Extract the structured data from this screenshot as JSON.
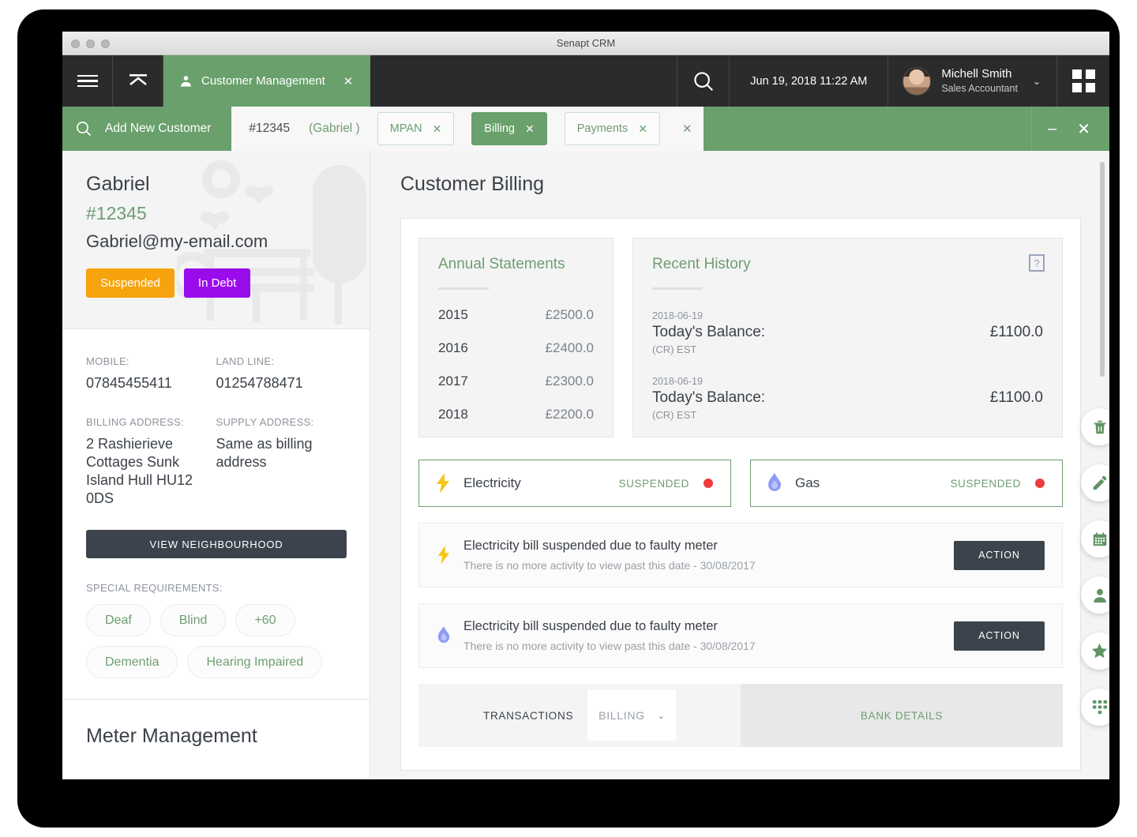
{
  "window": {
    "title": "Senapt CRM"
  },
  "topnav": {
    "menu_icon": "hamburger-icon",
    "collapse_icon": "collapse-up-icon",
    "tab_label": "Customer Management",
    "tab_close": "✕",
    "search_icon": "search-icon",
    "datetime": "Jun 19, 2018 11:22 AM",
    "user_name": "Michell Smith",
    "user_role": "Sales Accountant",
    "user_chevron": "⌄",
    "apps_icon": "grid-apps-icon"
  },
  "subbar": {
    "search_icon": "search-icon",
    "add_label": "Add New Customer",
    "customer_id": "#12345",
    "customer_name": "(Gabriel )",
    "tabs": [
      {
        "label": "MPAN",
        "close": "✕",
        "active": false
      },
      {
        "label": "Billing",
        "close": "✕",
        "active": true
      },
      {
        "label": "Payments",
        "close": "✕",
        "active": false
      }
    ],
    "close_all": "✕",
    "minimize": "–",
    "close": "✕"
  },
  "sidebar": {
    "customer": {
      "name": "Gabriel",
      "id": "#12345",
      "email": "Gabriel@my-email.com"
    },
    "badges": [
      {
        "label": "Suspended",
        "color": "#f7a30d"
      },
      {
        "label": "In Debt",
        "color": "#9b0ced"
      }
    ],
    "fields": [
      {
        "label": "MOBILE:",
        "value": "07845455411"
      },
      {
        "label": "LAND LINE:",
        "value": "01254788471"
      },
      {
        "label": "BILLING ADDRESS:",
        "value": "2 Rashierieve Cottages Sunk Island Hull HU12 0DS"
      },
      {
        "label": "SUPPLY ADDRESS:",
        "value": "Same as billing address"
      }
    ],
    "view_neighbourhood": "VIEW NEIGHBOURHOOD",
    "special_requirements_label": "SPECIAL REQUIREMENTS:",
    "special_requirements": [
      "Deaf",
      "Blind",
      "+60",
      "Dementia",
      "Hearing Impaired"
    ],
    "meter_management_title": "Meter Management"
  },
  "main": {
    "page_title": "Customer Billing",
    "annual": {
      "title": "Annual Statements",
      "rows": [
        {
          "year": "2015",
          "amount": "£2500.0"
        },
        {
          "year": "2016",
          "amount": "£2400.0"
        },
        {
          "year": "2017",
          "amount": "£2300.0"
        },
        {
          "year": "2018",
          "amount": "£2200.0"
        }
      ]
    },
    "history": {
      "title": "Recent History",
      "help": "?",
      "entries": [
        {
          "date": "2018-06-19",
          "label": "Today's Balance:",
          "note": "(CR) EST",
          "amount": "£1100.0"
        },
        {
          "date": "2018-06-19",
          "label": "Today's Balance:",
          "note": "(CR) EST",
          "amount": "£1100.0"
        }
      ]
    },
    "utilities": [
      {
        "icon": "lightning-bolt-icon",
        "name": "Electricity",
        "status": "SUSPENDED",
        "status_color": "#ef3b3b"
      },
      {
        "icon": "flame-icon",
        "name": "Gas",
        "status": "SUSPENDED",
        "status_color": "#ef3b3b"
      }
    ],
    "activities": [
      {
        "icon": "lightning-bolt-icon",
        "title": "Electricity bill suspended due to faulty meter",
        "subtitle": "There is no more activity to view past this date - 30/08/2017",
        "action": "ACTION"
      },
      {
        "icon": "flame-icon",
        "title": "Electricity bill suspended due to faulty meter",
        "subtitle": "There is no more activity to view past this date - 30/08/2017",
        "action": "ACTION"
      }
    ],
    "tabstrip": {
      "transactions_label": "TRANSACTIONS",
      "select_value": "BILLING",
      "select_chevron": "⌄",
      "bank_details_label": "BANK DETAILS"
    }
  },
  "fabs": [
    {
      "name": "delete-fab",
      "icon": "trash-icon"
    },
    {
      "name": "edit-fab",
      "icon": "pencil-icon"
    },
    {
      "name": "calendar-fab",
      "icon": "calendar-icon"
    },
    {
      "name": "contact-fab",
      "icon": "user-icon"
    },
    {
      "name": "favourite-fab",
      "icon": "star-icon"
    },
    {
      "name": "keypad-fab",
      "icon": "dialpad-icon"
    }
  ],
  "theme": {
    "green": "#69a06c",
    "dark": "#2b2b2b",
    "slate": "#3c434d",
    "red": "#ef3b3b",
    "amber": "#f7a30d",
    "purple": "#9b0ced"
  }
}
